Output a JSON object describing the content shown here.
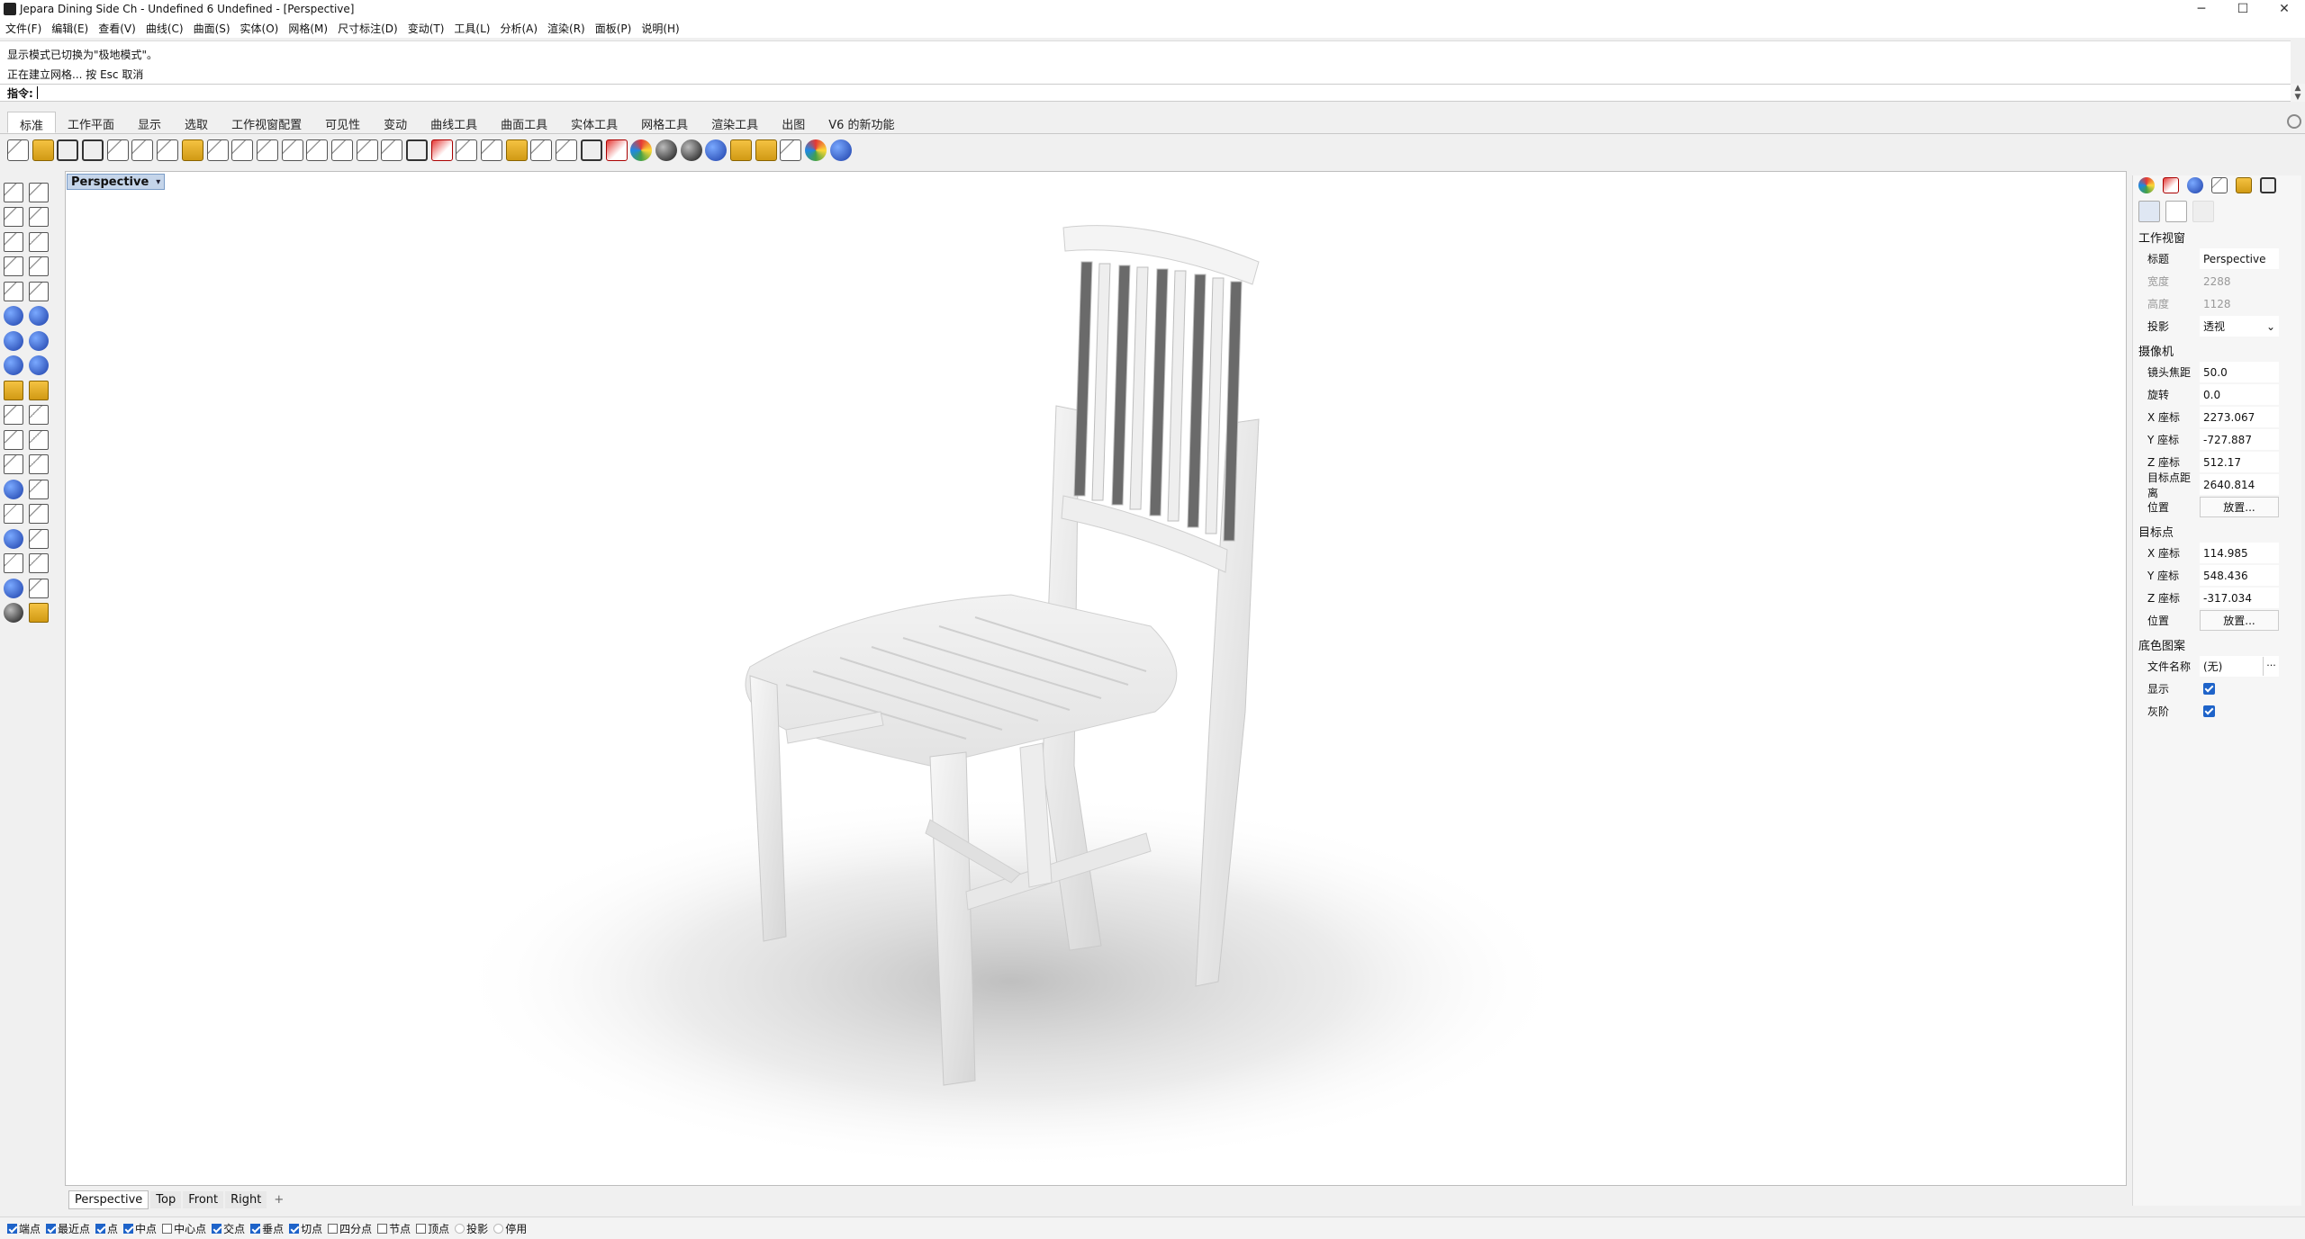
{
  "window": {
    "title": "Jepara Dining Side Ch - Undefined 6 Undefined - [Perspective]",
    "controls": [
      "─",
      "☐",
      "✕"
    ]
  },
  "menu": [
    "文件(F)",
    "编辑(E)",
    "查看(V)",
    "曲线(C)",
    "曲面(S)",
    "实体(O)",
    "网格(M)",
    "尺寸标注(D)",
    "变动(T)",
    "工具(L)",
    "分析(A)",
    "渲染(R)",
    "面板(P)",
    "说明(H)"
  ],
  "command": {
    "history": [
      "显示模式已切换为\"极地模式\"。",
      "正在建立网格... 按 Esc 取消"
    ],
    "prompt_label": "指令:",
    "input_value": ""
  },
  "toolbar_tabs": [
    "标准",
    "工作平面",
    "显示",
    "选取",
    "工作视窗配置",
    "可见性",
    "变动",
    "曲线工具",
    "曲面工具",
    "实体工具",
    "网格工具",
    "渲染工具",
    "出图",
    "V6 的新功能"
  ],
  "toolbar_icons": [
    "new-file-icon",
    "open-file-icon",
    "save-icon",
    "print-icon",
    "export-icon",
    "cut-icon",
    "copy-icon",
    "paste-icon",
    "undo-icon",
    "pan-hand-icon",
    "move-view-icon",
    "zoom-dynamic-icon",
    "zoom-window-icon",
    "zoom-extents-icon",
    "zoom-selected-icon",
    "rotate-view-icon",
    "four-view-icon",
    "layout-icon",
    "object-properties-icon",
    "shade-icon",
    "grid-snap-icon",
    "sun-icon",
    "light-bulb-icon",
    "lock-icon",
    "material-icon",
    "color-wheel-icon",
    "render-sphere-icon",
    "render-preview-icon",
    "environment-sphere-icon",
    "lasso-icon",
    "options-gear-icon",
    "transform-icon",
    "plugin-globe-icon",
    "help-icon"
  ],
  "viewport": {
    "name": "Perspective",
    "tabs": [
      "Perspective",
      "Top",
      "Front",
      "Right"
    ],
    "add_symbol": "+"
  },
  "osnaps": [
    {
      "label": "端点",
      "on": true
    },
    {
      "label": "最近点",
      "on": true
    },
    {
      "label": "点",
      "on": true
    },
    {
      "label": "中点",
      "on": true
    },
    {
      "label": "中心点",
      "on": false
    },
    {
      "label": "交点",
      "on": true
    },
    {
      "label": "垂点",
      "on": true
    },
    {
      "label": "切点",
      "on": true
    },
    {
      "label": "四分点",
      "on": false
    },
    {
      "label": "节点",
      "on": false
    },
    {
      "label": "顶点",
      "on": false
    },
    {
      "label": "投影",
      "on": false
    },
    {
      "label": "停用",
      "on": false
    }
  ],
  "panel": {
    "viewport_section": "工作视窗",
    "title_label": "标题",
    "title_value": "Perspective",
    "width_label": "宽度",
    "width_value": "2288",
    "height_label": "高度",
    "height_value": "1128",
    "projection_label": "投影",
    "projection_value": "透视",
    "camera_section": "摄像机",
    "lens_label": "镜头焦距",
    "lens_value": "50.0",
    "rotation_label": "旋转",
    "rotation_value": "0.0",
    "cam_x_label": "X 座标",
    "cam_x_value": "2273.067",
    "cam_y_label": "Y 座标",
    "cam_y_value": "-727.887",
    "cam_z_label": "Z 座标",
    "cam_z_value": "512.17",
    "target_dist_label": "目标点距离",
    "target_dist_value": "2640.814",
    "position_label": "位置",
    "place_button": "放置...",
    "target_section": "目标点",
    "tgt_x_label": "X 座标",
    "tgt_x_value": "114.985",
    "tgt_y_label": "Y 座标",
    "tgt_y_value": "548.436",
    "tgt_z_label": "Z 座标",
    "tgt_z_value": "-317.034",
    "tgt_position_label": "位置",
    "tgt_place_button": "放置...",
    "wallpaper_section": "底色图案",
    "filename_label": "文件名称",
    "filename_value": "(无)",
    "browse": "...",
    "show_label": "显示",
    "show_checked": true,
    "gray_label": "灰阶",
    "gray_checked": true
  }
}
